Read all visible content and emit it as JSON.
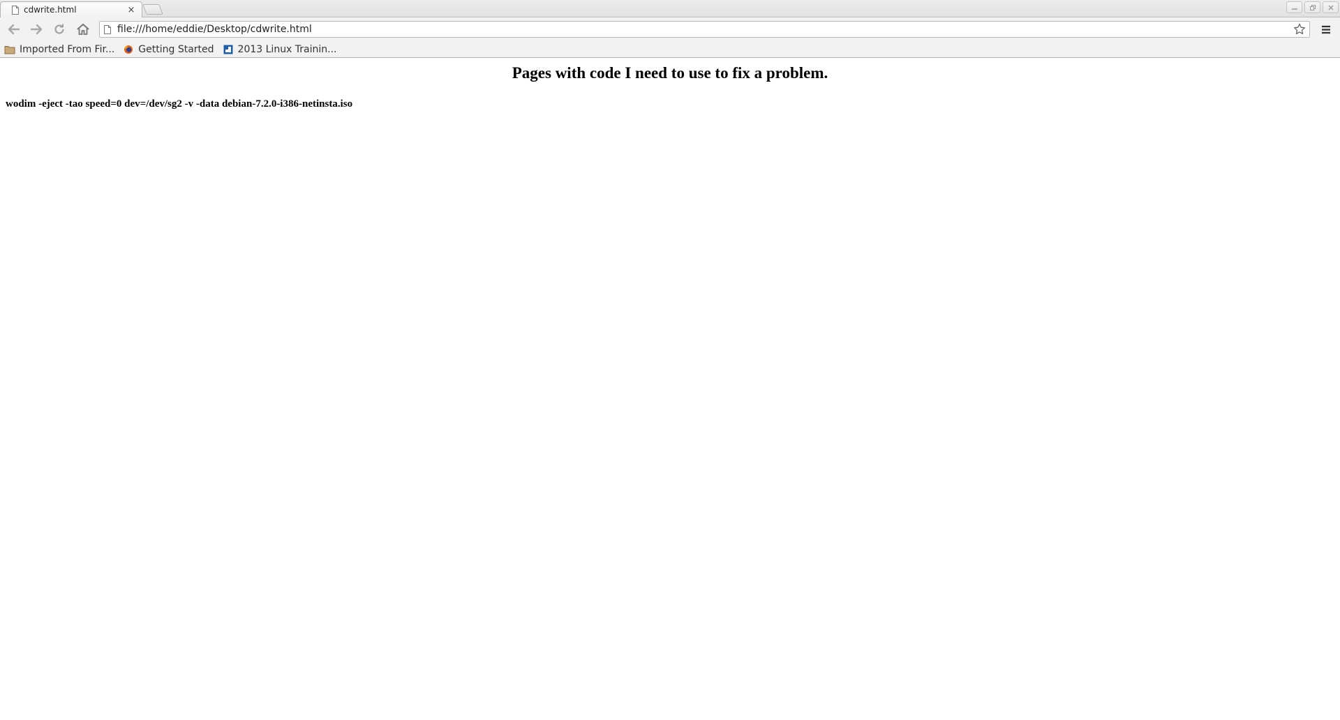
{
  "browser": {
    "tab": {
      "title": "cdwrite.html",
      "close_glyph": "×",
      "favicon": "page-icon"
    },
    "window_controls": [
      "minimize-icon",
      "restore-icon",
      "close-icon"
    ],
    "toolbar": {
      "back": "back-arrow-icon",
      "forward": "forward-arrow-icon",
      "reload": "reload-icon",
      "home": "home-icon",
      "url": "file:///home/eddie/Desktop/cdwrite.html",
      "star": "bookmark-star-icon",
      "menu": "hamburger-menu-icon"
    },
    "bookmarks": [
      {
        "label": "Imported From Fir...",
        "icon": "folder-icon"
      },
      {
        "label": "Getting Started",
        "icon": "firefox-icon"
      },
      {
        "label": "2013 Linux Trainin...",
        "icon": "site-favicon-icon"
      }
    ]
  },
  "page": {
    "heading": "Pages with code I need to use to fix a problem.",
    "code_line": "wodim -eject -tao speed=0 dev=/dev/sg2 -v -data debian-7.2.0-i386-netinsta.iso"
  }
}
